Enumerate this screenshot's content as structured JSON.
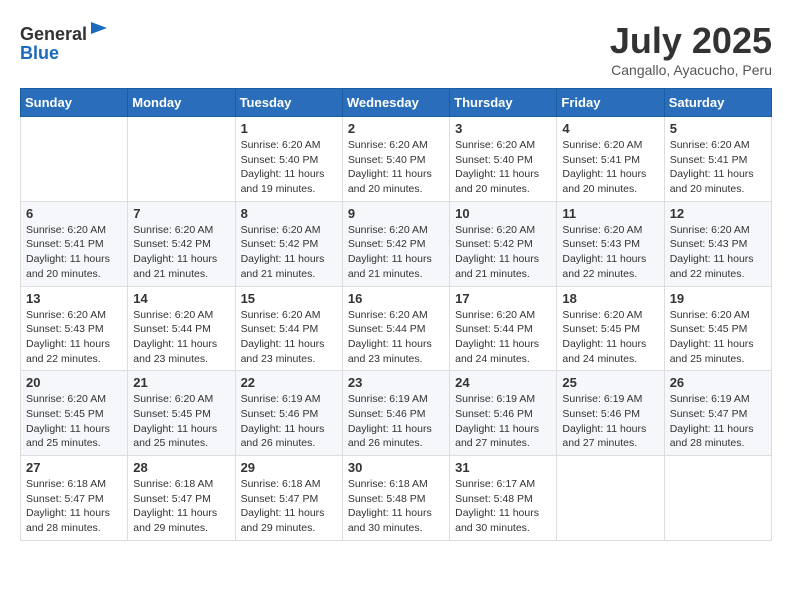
{
  "header": {
    "logo_general": "General",
    "logo_blue": "Blue",
    "month_title": "July 2025",
    "subtitle": "Cangallo, Ayacucho, Peru"
  },
  "days_of_week": [
    "Sunday",
    "Monday",
    "Tuesday",
    "Wednesday",
    "Thursday",
    "Friday",
    "Saturday"
  ],
  "weeks": [
    [
      {
        "day": "",
        "detail": ""
      },
      {
        "day": "",
        "detail": ""
      },
      {
        "day": "1",
        "detail": "Sunrise: 6:20 AM\nSunset: 5:40 PM\nDaylight: 11 hours and 19 minutes."
      },
      {
        "day": "2",
        "detail": "Sunrise: 6:20 AM\nSunset: 5:40 PM\nDaylight: 11 hours and 20 minutes."
      },
      {
        "day": "3",
        "detail": "Sunrise: 6:20 AM\nSunset: 5:40 PM\nDaylight: 11 hours and 20 minutes."
      },
      {
        "day": "4",
        "detail": "Sunrise: 6:20 AM\nSunset: 5:41 PM\nDaylight: 11 hours and 20 minutes."
      },
      {
        "day": "5",
        "detail": "Sunrise: 6:20 AM\nSunset: 5:41 PM\nDaylight: 11 hours and 20 minutes."
      }
    ],
    [
      {
        "day": "6",
        "detail": "Sunrise: 6:20 AM\nSunset: 5:41 PM\nDaylight: 11 hours and 20 minutes."
      },
      {
        "day": "7",
        "detail": "Sunrise: 6:20 AM\nSunset: 5:42 PM\nDaylight: 11 hours and 21 minutes."
      },
      {
        "day": "8",
        "detail": "Sunrise: 6:20 AM\nSunset: 5:42 PM\nDaylight: 11 hours and 21 minutes."
      },
      {
        "day": "9",
        "detail": "Sunrise: 6:20 AM\nSunset: 5:42 PM\nDaylight: 11 hours and 21 minutes."
      },
      {
        "day": "10",
        "detail": "Sunrise: 6:20 AM\nSunset: 5:42 PM\nDaylight: 11 hours and 21 minutes."
      },
      {
        "day": "11",
        "detail": "Sunrise: 6:20 AM\nSunset: 5:43 PM\nDaylight: 11 hours and 22 minutes."
      },
      {
        "day": "12",
        "detail": "Sunrise: 6:20 AM\nSunset: 5:43 PM\nDaylight: 11 hours and 22 minutes."
      }
    ],
    [
      {
        "day": "13",
        "detail": "Sunrise: 6:20 AM\nSunset: 5:43 PM\nDaylight: 11 hours and 22 minutes."
      },
      {
        "day": "14",
        "detail": "Sunrise: 6:20 AM\nSunset: 5:44 PM\nDaylight: 11 hours and 23 minutes."
      },
      {
        "day": "15",
        "detail": "Sunrise: 6:20 AM\nSunset: 5:44 PM\nDaylight: 11 hours and 23 minutes."
      },
      {
        "day": "16",
        "detail": "Sunrise: 6:20 AM\nSunset: 5:44 PM\nDaylight: 11 hours and 23 minutes."
      },
      {
        "day": "17",
        "detail": "Sunrise: 6:20 AM\nSunset: 5:44 PM\nDaylight: 11 hours and 24 minutes."
      },
      {
        "day": "18",
        "detail": "Sunrise: 6:20 AM\nSunset: 5:45 PM\nDaylight: 11 hours and 24 minutes."
      },
      {
        "day": "19",
        "detail": "Sunrise: 6:20 AM\nSunset: 5:45 PM\nDaylight: 11 hours and 25 minutes."
      }
    ],
    [
      {
        "day": "20",
        "detail": "Sunrise: 6:20 AM\nSunset: 5:45 PM\nDaylight: 11 hours and 25 minutes."
      },
      {
        "day": "21",
        "detail": "Sunrise: 6:20 AM\nSunset: 5:45 PM\nDaylight: 11 hours and 25 minutes."
      },
      {
        "day": "22",
        "detail": "Sunrise: 6:19 AM\nSunset: 5:46 PM\nDaylight: 11 hours and 26 minutes."
      },
      {
        "day": "23",
        "detail": "Sunrise: 6:19 AM\nSunset: 5:46 PM\nDaylight: 11 hours and 26 minutes."
      },
      {
        "day": "24",
        "detail": "Sunrise: 6:19 AM\nSunset: 5:46 PM\nDaylight: 11 hours and 27 minutes."
      },
      {
        "day": "25",
        "detail": "Sunrise: 6:19 AM\nSunset: 5:46 PM\nDaylight: 11 hours and 27 minutes."
      },
      {
        "day": "26",
        "detail": "Sunrise: 6:19 AM\nSunset: 5:47 PM\nDaylight: 11 hours and 28 minutes."
      }
    ],
    [
      {
        "day": "27",
        "detail": "Sunrise: 6:18 AM\nSunset: 5:47 PM\nDaylight: 11 hours and 28 minutes."
      },
      {
        "day": "28",
        "detail": "Sunrise: 6:18 AM\nSunset: 5:47 PM\nDaylight: 11 hours and 29 minutes."
      },
      {
        "day": "29",
        "detail": "Sunrise: 6:18 AM\nSunset: 5:47 PM\nDaylight: 11 hours and 29 minutes."
      },
      {
        "day": "30",
        "detail": "Sunrise: 6:18 AM\nSunset: 5:48 PM\nDaylight: 11 hours and 30 minutes."
      },
      {
        "day": "31",
        "detail": "Sunrise: 6:17 AM\nSunset: 5:48 PM\nDaylight: 11 hours and 30 minutes."
      },
      {
        "day": "",
        "detail": ""
      },
      {
        "day": "",
        "detail": ""
      }
    ]
  ]
}
